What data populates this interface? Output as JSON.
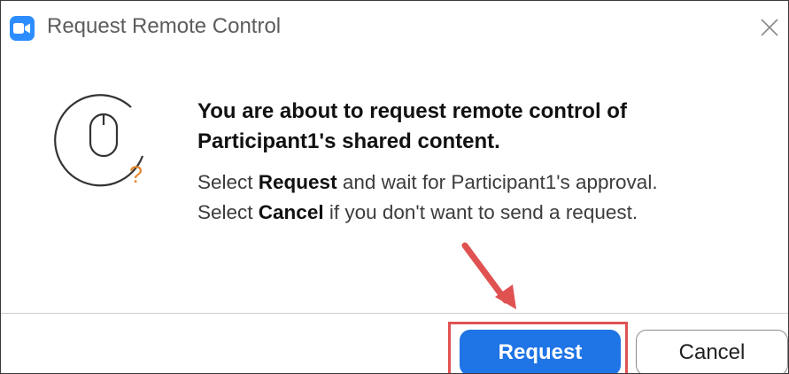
{
  "window": {
    "title": "Request Remote Control",
    "app_icon": "zoom-camera-icon",
    "close_icon": "close-icon"
  },
  "content": {
    "icon": "mouse-question-icon",
    "heading_line1": "You are about to request remote control of",
    "heading_line2": "Participant1's shared content.",
    "line1_prefix": "Select ",
    "line1_bold": "Request",
    "line1_suffix": " and wait for Participant1's approval.",
    "line2_prefix": "Select ",
    "line2_bold": "Cancel",
    "line2_suffix": " if you don't want to send a request."
  },
  "buttons": {
    "request_label": "Request",
    "cancel_label": "Cancel"
  },
  "annotation": {
    "arrow_icon": "red-arrow-icon",
    "highlight_color": "#e05252"
  },
  "colors": {
    "primary": "#1f74e6",
    "app_icon": "#2D8CFF",
    "question_mark": "#e8872e"
  }
}
